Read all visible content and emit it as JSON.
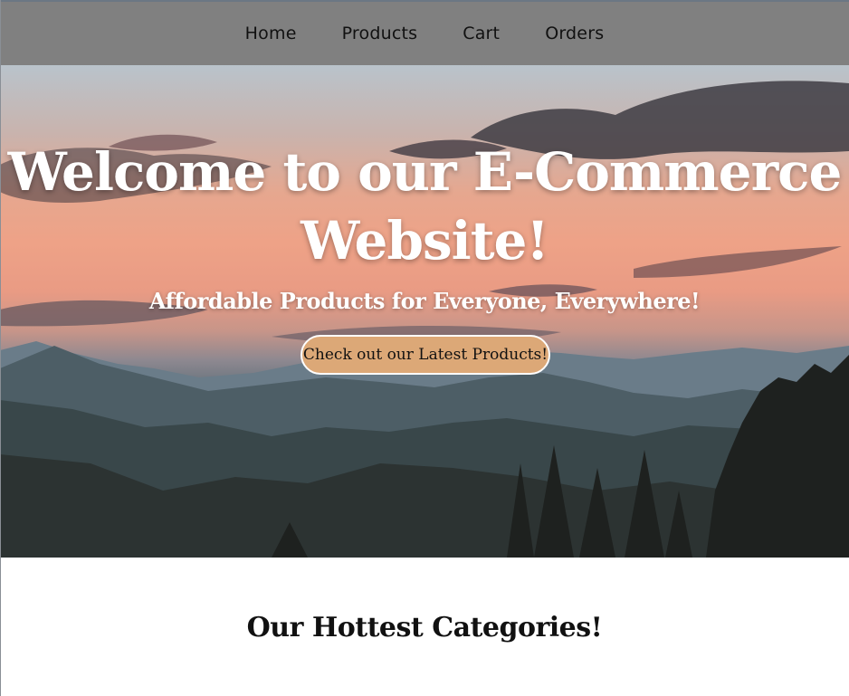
{
  "nav": {
    "items": [
      {
        "label": "Home"
      },
      {
        "label": "Products"
      },
      {
        "label": "Cart"
      },
      {
        "label": "Orders"
      }
    ]
  },
  "hero": {
    "title": "Welcome to our E-Commerce Website!",
    "subtitle": "Affordable Products for Everyone, Everywhere!",
    "button_label": "Check out our Latest Products!"
  },
  "categories": {
    "heading": "Our Hottest Categories!"
  },
  "colors": {
    "nav_background": "#808080",
    "button_background": "#dca877",
    "hero_text": "#ffffff"
  }
}
